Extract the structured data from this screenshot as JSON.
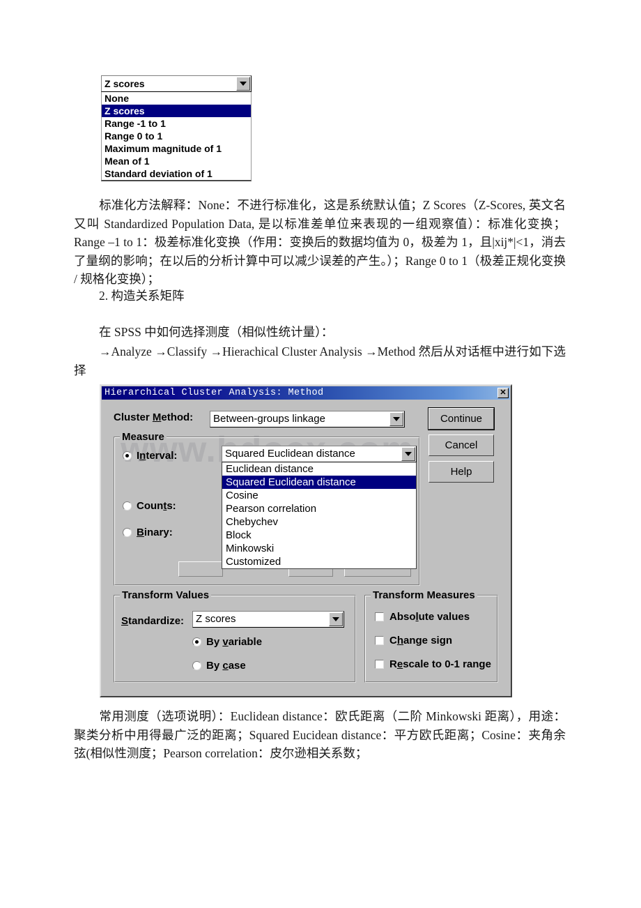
{
  "standardize_dropdown": {
    "selected": "Z scores",
    "options": [
      "None",
      "Z scores",
      "Range -1 to 1",
      "Range 0 to 1",
      "Maximum magnitude of 1",
      "Mean of 1",
      "Standard deviation of 1"
    ],
    "highlighted_index": 1
  },
  "document": {
    "paragraph_1": "标准化方法解释：None：不进行标准化，这是系统默认值；Z Scores（Z-Scores, 英文名又叫 Standardized Population Data, 是以标准差单位来表现的一组观察值）：标准化变换；Range –1 to 1：极差标准化变换（作用：变换后的数据均值为 0，极差为 1，且|xij*|<1，消去了量纲的影响；在以后的分析计算中可以减少误差的产生。）；Range 0 to 1（极差正规化变换 / 规格化变换）；",
    "paragraph_2": "2. 构造关系矩阵",
    "paragraph_3": "在 SPSS 中如何选择测度（相似性统计量）：",
    "paragraph_4": "→Analyze →Classify →Hierachical Cluster Analysis →Method 然后从对话框中进行如下选择",
    "paragraph_5": "常用测度（选项说明）：Euclidean distance：欧氏距离（二阶 Minkowski 距离），用途：聚类分析中用得最广泛的距离；Squared Eucidean distance：平方欧氏距离；Cosine：夹角余弦(相似性测度；Pearson correlation：皮尔逊相关系数；"
  },
  "watermark": "www.bdocx.com",
  "dialog": {
    "title": "Hierarchical Cluster Analysis: Method",
    "close_label": "✕",
    "cluster_method": {
      "label": "Cluster Method:",
      "value": "Between-groups linkage"
    },
    "buttons": {
      "continue": "Continue",
      "cancel": "Cancel",
      "help": "Help"
    },
    "measure": {
      "title": "Measure",
      "radios": [
        {
          "label": "Interval:",
          "selected": true
        },
        {
          "label": "Counts:",
          "selected": false
        },
        {
          "label": "Binary:",
          "selected": false
        }
      ],
      "interval_dropdown": {
        "selected": "Squared Euclidean distance",
        "options": [
          "Euclidean distance",
          "Squared Euclidean distance",
          "Cosine",
          "Pearson correlation",
          "Chebychev",
          "Block",
          "Minkowski",
          "Customized"
        ],
        "highlighted_index": 1
      }
    },
    "transform_values": {
      "title": "Transform Values",
      "standardize_label": "Standardize:",
      "standardize_value": "Z scores",
      "radios": [
        {
          "label": "By variable",
          "selected": true
        },
        {
          "label": "By case",
          "selected": false
        }
      ]
    },
    "transform_measures": {
      "title": "Transform Measures",
      "checkboxes": [
        {
          "label": "Absolute values",
          "checked": false
        },
        {
          "label": "Change sign",
          "checked": false
        },
        {
          "label": "Rescale to 0-1 range",
          "checked": false
        }
      ]
    }
  },
  "colors": {
    "dialog_face": "#c0c0c0",
    "selection_blue": "#000080",
    "titlebar_start": "#00007a",
    "titlebar_end": "#8fb6e4"
  }
}
